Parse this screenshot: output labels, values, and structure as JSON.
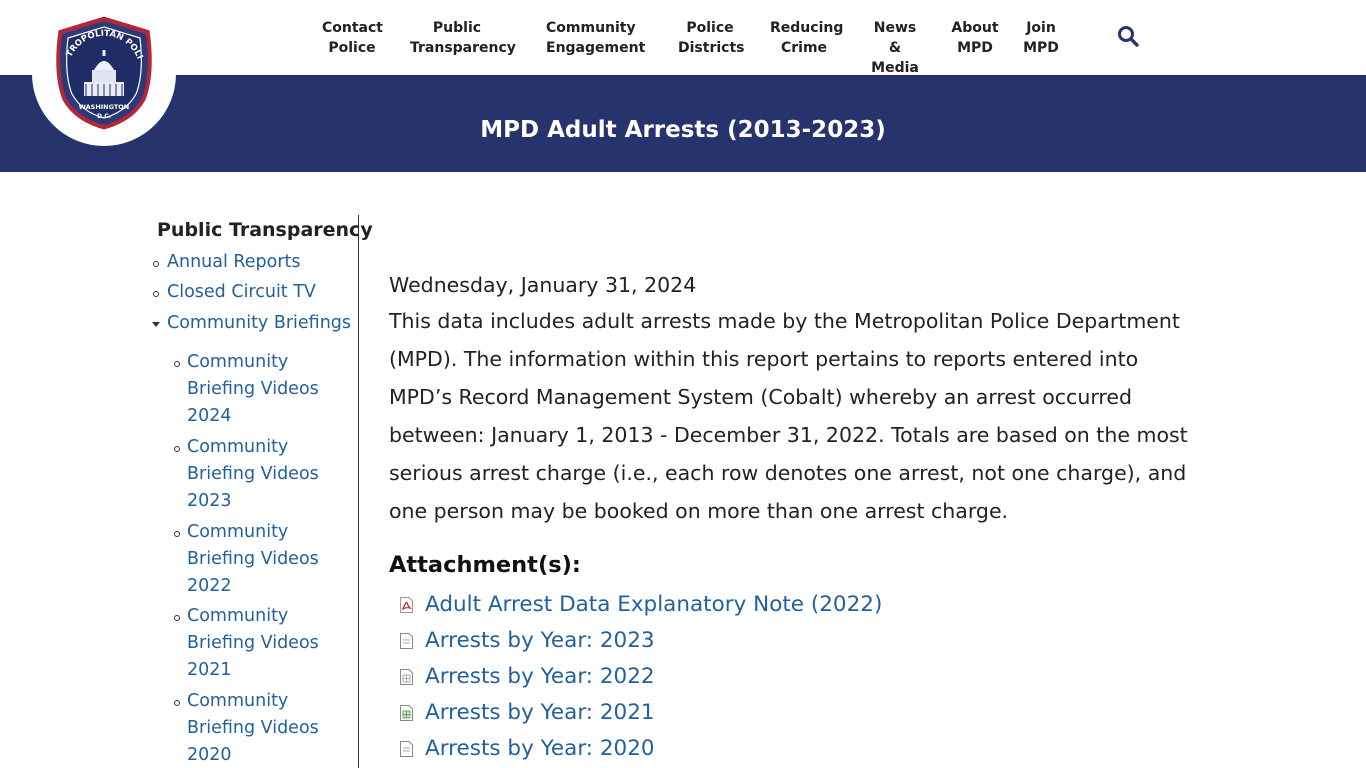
{
  "nav": {
    "items": [
      {
        "line1": "Contact",
        "line2": "Police"
      },
      {
        "line1": "Public",
        "line2": "Transparency"
      },
      {
        "line1": "Community",
        "line2": "Engagement"
      },
      {
        "line1": "Police",
        "line2": "Districts"
      },
      {
        "line1": "Reducing",
        "line2": "Crime"
      },
      {
        "line1": "News &",
        "line2": "Media"
      },
      {
        "line1": "About",
        "line2": "MPD"
      },
      {
        "line1": "Join",
        "line2": "MPD"
      }
    ],
    "search_icon": "search-icon"
  },
  "logo": {
    "top_text": "METROPOLITAN POLICE",
    "bottom_text": "WASHINGTON",
    "sub_text": "D.C."
  },
  "banner": {
    "title": "MPD Adult Arrests (2013-2023)"
  },
  "sidebar": {
    "title": "Public Transparency",
    "items": [
      {
        "label": "Annual Reports"
      },
      {
        "label": "Closed Circuit TV"
      },
      {
        "label": "Community Briefings",
        "expanded": true
      }
    ],
    "subitems": [
      {
        "line1": "Community",
        "line2": "Briefing Videos",
        "line3": "2024"
      },
      {
        "line1": "Community",
        "line2": "Briefing Videos",
        "line3": "2023"
      },
      {
        "line1": "Community",
        "line2": "Briefing Videos",
        "line3": "2022"
      },
      {
        "line1": "Community",
        "line2": "Briefing Videos",
        "line3": "2021"
      },
      {
        "line1": "Community",
        "line2": "Briefing Videos",
        "line3": "2020"
      }
    ]
  },
  "main": {
    "date": "Wednesday, January 31, 2024",
    "body_lines": [
      "This data includes adult arrests made by the Metropolitan Police Department",
      "(MPD). The information within this report pertains to reports entered into",
      "MPD’s Record Management System (Cobalt) whereby an arrest occurred",
      "between: January 1, 2013 - December 31, 2022. Totals are based on the most",
      "serious arrest charge (i.e., each row denotes one arrest, not one charge), and",
      "one person may be booked on more than one arrest charge."
    ],
    "attachments_title": "Attachment(s):",
    "attachments": [
      {
        "label": "Adult Arrest Data Explanatory Note (2022)",
        "icon": "pdf-file-icon",
        "color": "#c0282d"
      },
      {
        "label": "Arrests by Year: 2023",
        "icon": "document-file-icon",
        "color": "#888888"
      },
      {
        "label": "Arrests by Year: 2022",
        "icon": "spreadsheet-file-icon",
        "color": "#888888"
      },
      {
        "label": "Arrests by Year: 2021",
        "icon": "spreadsheet-file-icon",
        "color": "#4a9a3a"
      },
      {
        "label": "Arrests by Year: 2020",
        "icon": "document-file-icon",
        "color": "#888888"
      }
    ]
  },
  "colors": {
    "banner": "#27336d",
    "link": "#23609c",
    "text": "#222222"
  }
}
